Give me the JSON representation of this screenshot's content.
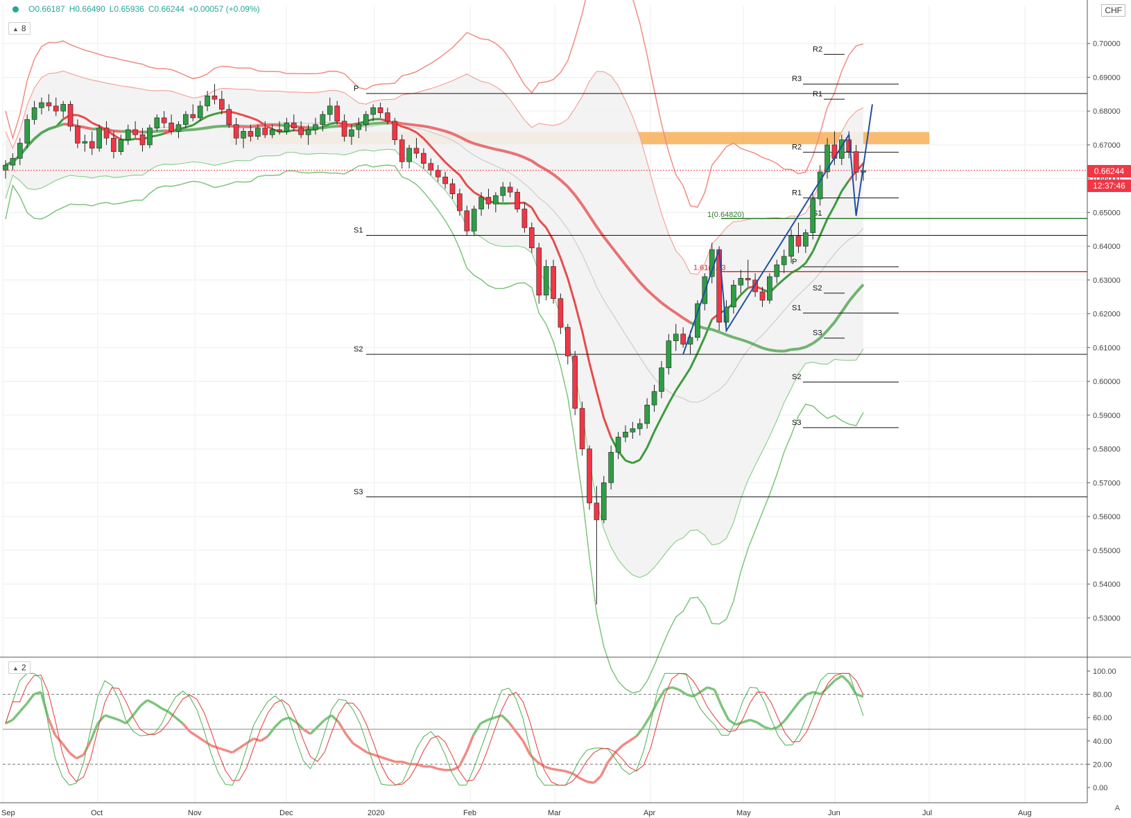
{
  "header": {
    "open": "O0.66187",
    "high": "H0.66490",
    "low": "L0.65936",
    "close": "C0.66244",
    "change": "+0.00057 (+0.09%)",
    "main_pane_count": "8",
    "osc_pane_count": "2",
    "currency": "CHF"
  },
  "price_tags": {
    "last": "0.66244",
    "countdown": "12:37:46"
  },
  "corner_label": "A",
  "colors": {
    "up": "#2e9e45",
    "down": "#f23645",
    "blue_line": "#1f4fa3",
    "zone": "#f7a440"
  },
  "chart_data": {
    "type": "candlestick",
    "ylim": [
      0.52,
      0.71
    ],
    "y_ticks": [
      "0.53000",
      "0.54000",
      "0.55000",
      "0.56000",
      "0.57000",
      "0.58000",
      "0.59000",
      "0.60000",
      "0.61000",
      "0.62000",
      "0.63000",
      "0.64000",
      "0.65000",
      "0.66000",
      "0.67000",
      "0.68000",
      "0.69000",
      "0.70000"
    ],
    "x_labels": [
      "Sep",
      "Oct",
      "Nov",
      "Dec",
      "2020",
      "Feb",
      "Mar",
      "Apr",
      "May",
      "Jun",
      "Jul",
      "Aug"
    ],
    "osc_ticks": [
      "0.00",
      "20.00",
      "40.00",
      "60.00",
      "80.00",
      "100.00"
    ],
    "pivot_levels": [
      {
        "label": "P",
        "value": 0.6852
      },
      {
        "label": "S1",
        "value": 0.6432
      },
      {
        "label": "S2",
        "value": 0.608
      },
      {
        "label": "S3",
        "value": 0.5658
      },
      {
        "label": "R3",
        "value": 0.688
      },
      {
        "label": "R1",
        "value": 0.6835
      },
      {
        "label": "R2",
        "value": 0.6968
      },
      {
        "label": "R2",
        "value": 0.6678
      },
      {
        "label": "R1",
        "value": 0.6543
      },
      {
        "label": "S1",
        "value": 0.6482
      },
      {
        "label": "P",
        "value": 0.6339
      },
      {
        "label": "S2",
        "value": 0.6261
      },
      {
        "label": "S1",
        "value": 0.6202
      },
      {
        "label": "S3",
        "value": 0.6128
      },
      {
        "label": "S2",
        "value": 0.5998
      },
      {
        "label": "S3",
        "value": 0.5863
      }
    ],
    "fib_labels": [
      {
        "label": "1(0.64820)",
        "value": 0.6482
      },
      {
        "label": "1.61(0.63",
        "value": 0.6325
      }
    ],
    "zone": [
      0.6702,
      0.6738
    ],
    "last_price": 0.66244,
    "ohlc": [
      [
        0.6625,
        0.6655,
        0.66,
        0.664
      ],
      [
        0.664,
        0.6675,
        0.6625,
        0.666
      ],
      [
        0.666,
        0.672,
        0.664,
        0.6705
      ],
      [
        0.6705,
        0.679,
        0.669,
        0.6775
      ],
      [
        0.6775,
        0.683,
        0.676,
        0.681
      ],
      [
        0.681,
        0.684,
        0.679,
        0.6825
      ],
      [
        0.6825,
        0.685,
        0.68,
        0.6815
      ],
      [
        0.6815,
        0.684,
        0.6785,
        0.68
      ],
      [
        0.68,
        0.683,
        0.678,
        0.682
      ],
      [
        0.682,
        0.683,
        0.674,
        0.6755
      ],
      [
        0.6755,
        0.6775,
        0.669,
        0.6705
      ],
      [
        0.6705,
        0.673,
        0.668,
        0.671
      ],
      [
        0.671,
        0.674,
        0.667,
        0.669
      ],
      [
        0.669,
        0.676,
        0.668,
        0.675
      ],
      [
        0.675,
        0.677,
        0.67,
        0.672
      ],
      [
        0.672,
        0.674,
        0.666,
        0.668
      ],
      [
        0.668,
        0.673,
        0.667,
        0.6715
      ],
      [
        0.6715,
        0.676,
        0.67,
        0.6745
      ],
      [
        0.6745,
        0.677,
        0.672,
        0.673
      ],
      [
        0.673,
        0.675,
        0.668,
        0.67
      ],
      [
        0.67,
        0.676,
        0.669,
        0.675
      ],
      [
        0.675,
        0.679,
        0.674,
        0.678
      ],
      [
        0.678,
        0.68,
        0.675,
        0.6765
      ],
      [
        0.6765,
        0.679,
        0.673,
        0.674
      ],
      [
        0.674,
        0.677,
        0.672,
        0.676
      ],
      [
        0.676,
        0.68,
        0.675,
        0.679
      ],
      [
        0.679,
        0.682,
        0.677,
        0.678
      ],
      [
        0.678,
        0.683,
        0.677,
        0.6815
      ],
      [
        0.6815,
        0.686,
        0.68,
        0.6845
      ],
      [
        0.6845,
        0.688,
        0.682,
        0.6835
      ],
      [
        0.6835,
        0.686,
        0.679,
        0.6805
      ],
      [
        0.6805,
        0.682,
        0.675,
        0.676
      ],
      [
        0.676,
        0.678,
        0.67,
        0.672
      ],
      [
        0.672,
        0.675,
        0.669,
        0.674
      ],
      [
        0.674,
        0.676,
        0.671,
        0.6725
      ],
      [
        0.6725,
        0.676,
        0.6715,
        0.675
      ],
      [
        0.675,
        0.677,
        0.672,
        0.673
      ],
      [
        0.673,
        0.676,
        0.672,
        0.6745
      ],
      [
        0.6745,
        0.677,
        0.673,
        0.674
      ],
      [
        0.674,
        0.678,
        0.673,
        0.6765
      ],
      [
        0.6765,
        0.679,
        0.674,
        0.675
      ],
      [
        0.675,
        0.677,
        0.672,
        0.673
      ],
      [
        0.673,
        0.676,
        0.67,
        0.6745
      ],
      [
        0.6745,
        0.678,
        0.673,
        0.676
      ],
      [
        0.676,
        0.68,
        0.674,
        0.679
      ],
      [
        0.679,
        0.684,
        0.677,
        0.6815
      ],
      [
        0.6815,
        0.683,
        0.676,
        0.677
      ],
      [
        0.677,
        0.679,
        0.671,
        0.6725
      ],
      [
        0.6725,
        0.676,
        0.67,
        0.6745
      ],
      [
        0.6745,
        0.678,
        0.672,
        0.676
      ],
      [
        0.676,
        0.68,
        0.674,
        0.679
      ],
      [
        0.679,
        0.682,
        0.677,
        0.681
      ],
      [
        0.681,
        0.6825,
        0.678,
        0.6795
      ],
      [
        0.6795,
        0.681,
        0.676,
        0.677
      ],
      [
        0.677,
        0.678,
        0.67,
        0.6715
      ],
      [
        0.6715,
        0.673,
        0.663,
        0.665
      ],
      [
        0.665,
        0.67,
        0.663,
        0.669
      ],
      [
        0.669,
        0.672,
        0.666,
        0.6675
      ],
      [
        0.6675,
        0.669,
        0.663,
        0.6645
      ],
      [
        0.6645,
        0.666,
        0.661,
        0.6625
      ],
      [
        0.6625,
        0.664,
        0.659,
        0.6605
      ],
      [
        0.6605,
        0.662,
        0.657,
        0.6585
      ],
      [
        0.6585,
        0.66,
        0.654,
        0.6555
      ],
      [
        0.6555,
        0.657,
        0.649,
        0.6505
      ],
      [
        0.6505,
        0.652,
        0.643,
        0.6445
      ],
      [
        0.6445,
        0.652,
        0.643,
        0.651
      ],
      [
        0.651,
        0.656,
        0.649,
        0.6545
      ],
      [
        0.6545,
        0.657,
        0.651,
        0.6525
      ],
      [
        0.6525,
        0.656,
        0.65,
        0.655
      ],
      [
        0.655,
        0.659,
        0.653,
        0.6575
      ],
      [
        0.6575,
        0.659,
        0.6545,
        0.656
      ],
      [
        0.656,
        0.657,
        0.65,
        0.651
      ],
      [
        0.651,
        0.653,
        0.644,
        0.6455
      ],
      [
        0.6455,
        0.647,
        0.638,
        0.6395
      ],
      [
        0.6395,
        0.641,
        0.623,
        0.6255
      ],
      [
        0.6255,
        0.636,
        0.624,
        0.634
      ],
      [
        0.634,
        0.636,
        0.623,
        0.6245
      ],
      [
        0.6245,
        0.626,
        0.614,
        0.616
      ],
      [
        0.616,
        0.617,
        0.605,
        0.6075
      ],
      [
        0.6075,
        0.609,
        0.59,
        0.592
      ],
      [
        0.592,
        0.594,
        0.578,
        0.58
      ],
      [
        0.58,
        0.581,
        0.562,
        0.564
      ],
      [
        0.564,
        0.569,
        0.534,
        0.559
      ],
      [
        0.559,
        0.572,
        0.558,
        0.57
      ],
      [
        0.57,
        0.581,
        0.568,
        0.579
      ],
      [
        0.579,
        0.585,
        0.577,
        0.5835
      ],
      [
        0.5835,
        0.587,
        0.582,
        0.585
      ],
      [
        0.585,
        0.588,
        0.583,
        0.586
      ],
      [
        0.586,
        0.589,
        0.584,
        0.5875
      ],
      [
        0.5875,
        0.595,
        0.586,
        0.593
      ],
      [
        0.593,
        0.599,
        0.591,
        0.597
      ],
      [
        0.597,
        0.606,
        0.595,
        0.604
      ],
      [
        0.604,
        0.614,
        0.602,
        0.612
      ],
      [
        0.612,
        0.617,
        0.609,
        0.614
      ],
      [
        0.614,
        0.616,
        0.61,
        0.611
      ],
      [
        0.611,
        0.615,
        0.608,
        0.613
      ],
      [
        0.613,
        0.624,
        0.612,
        0.623
      ],
      [
        0.623,
        0.632,
        0.621,
        0.631
      ],
      [
        0.631,
        0.641,
        0.629,
        0.639
      ],
      [
        0.639,
        0.64,
        0.615,
        0.6175
      ],
      [
        0.6175,
        0.624,
        0.616,
        0.622
      ],
      [
        0.622,
        0.63,
        0.62,
        0.6285
      ],
      [
        0.6285,
        0.633,
        0.626,
        0.6305
      ],
      [
        0.6305,
        0.636,
        0.628,
        0.63
      ],
      [
        0.63,
        0.632,
        0.625,
        0.6265
      ],
      [
        0.6265,
        0.628,
        0.622,
        0.624
      ],
      [
        0.624,
        0.632,
        0.623,
        0.631
      ],
      [
        0.631,
        0.636,
        0.629,
        0.6345
      ],
      [
        0.6345,
        0.639,
        0.632,
        0.637
      ],
      [
        0.637,
        0.645,
        0.635,
        0.643
      ],
      [
        0.643,
        0.647,
        0.638,
        0.64
      ],
      [
        0.64,
        0.645,
        0.638,
        0.644
      ],
      [
        0.644,
        0.656,
        0.642,
        0.654
      ],
      [
        0.654,
        0.664,
        0.652,
        0.662
      ],
      [
        0.662,
        0.672,
        0.66,
        0.67
      ],
      [
        0.67,
        0.674,
        0.664,
        0.666
      ],
      [
        0.666,
        0.673,
        0.664,
        0.6715
      ],
      [
        0.6715,
        0.674,
        0.666,
        0.668
      ],
      [
        0.668,
        0.67,
        0.6594,
        0.6619
      ],
      [
        0.6619,
        0.6649,
        0.6594,
        0.6624
      ]
    ],
    "osc_main": [
      55,
      58,
      65,
      72,
      80,
      82,
      60,
      45,
      38,
      30,
      25,
      28,
      40,
      55,
      62,
      60,
      58,
      55,
      62,
      70,
      75,
      72,
      68,
      65,
      60,
      55,
      48,
      44,
      40,
      36,
      34,
      32,
      30,
      34,
      38,
      42,
      40,
      44,
      52,
      58,
      60,
      56,
      50,
      46,
      52,
      58,
      62,
      56,
      46,
      38,
      34,
      30,
      28,
      26,
      24,
      22,
      22,
      20,
      20,
      18,
      18,
      16,
      15,
      15,
      18,
      30,
      45,
      55,
      58,
      60,
      62,
      56,
      48,
      40,
      28,
      22,
      18,
      16,
      15,
      14,
      12,
      8,
      5,
      4,
      10,
      22,
      30,
      36,
      40,
      44,
      52,
      62,
      74,
      84,
      86,
      84,
      80,
      78,
      82,
      86,
      84,
      70,
      58,
      54,
      56,
      58,
      56,
      52,
      50,
      52,
      58,
      66,
      74,
      80,
      82,
      80,
      86,
      92,
      96,
      90,
      80,
      78
    ]
  }
}
